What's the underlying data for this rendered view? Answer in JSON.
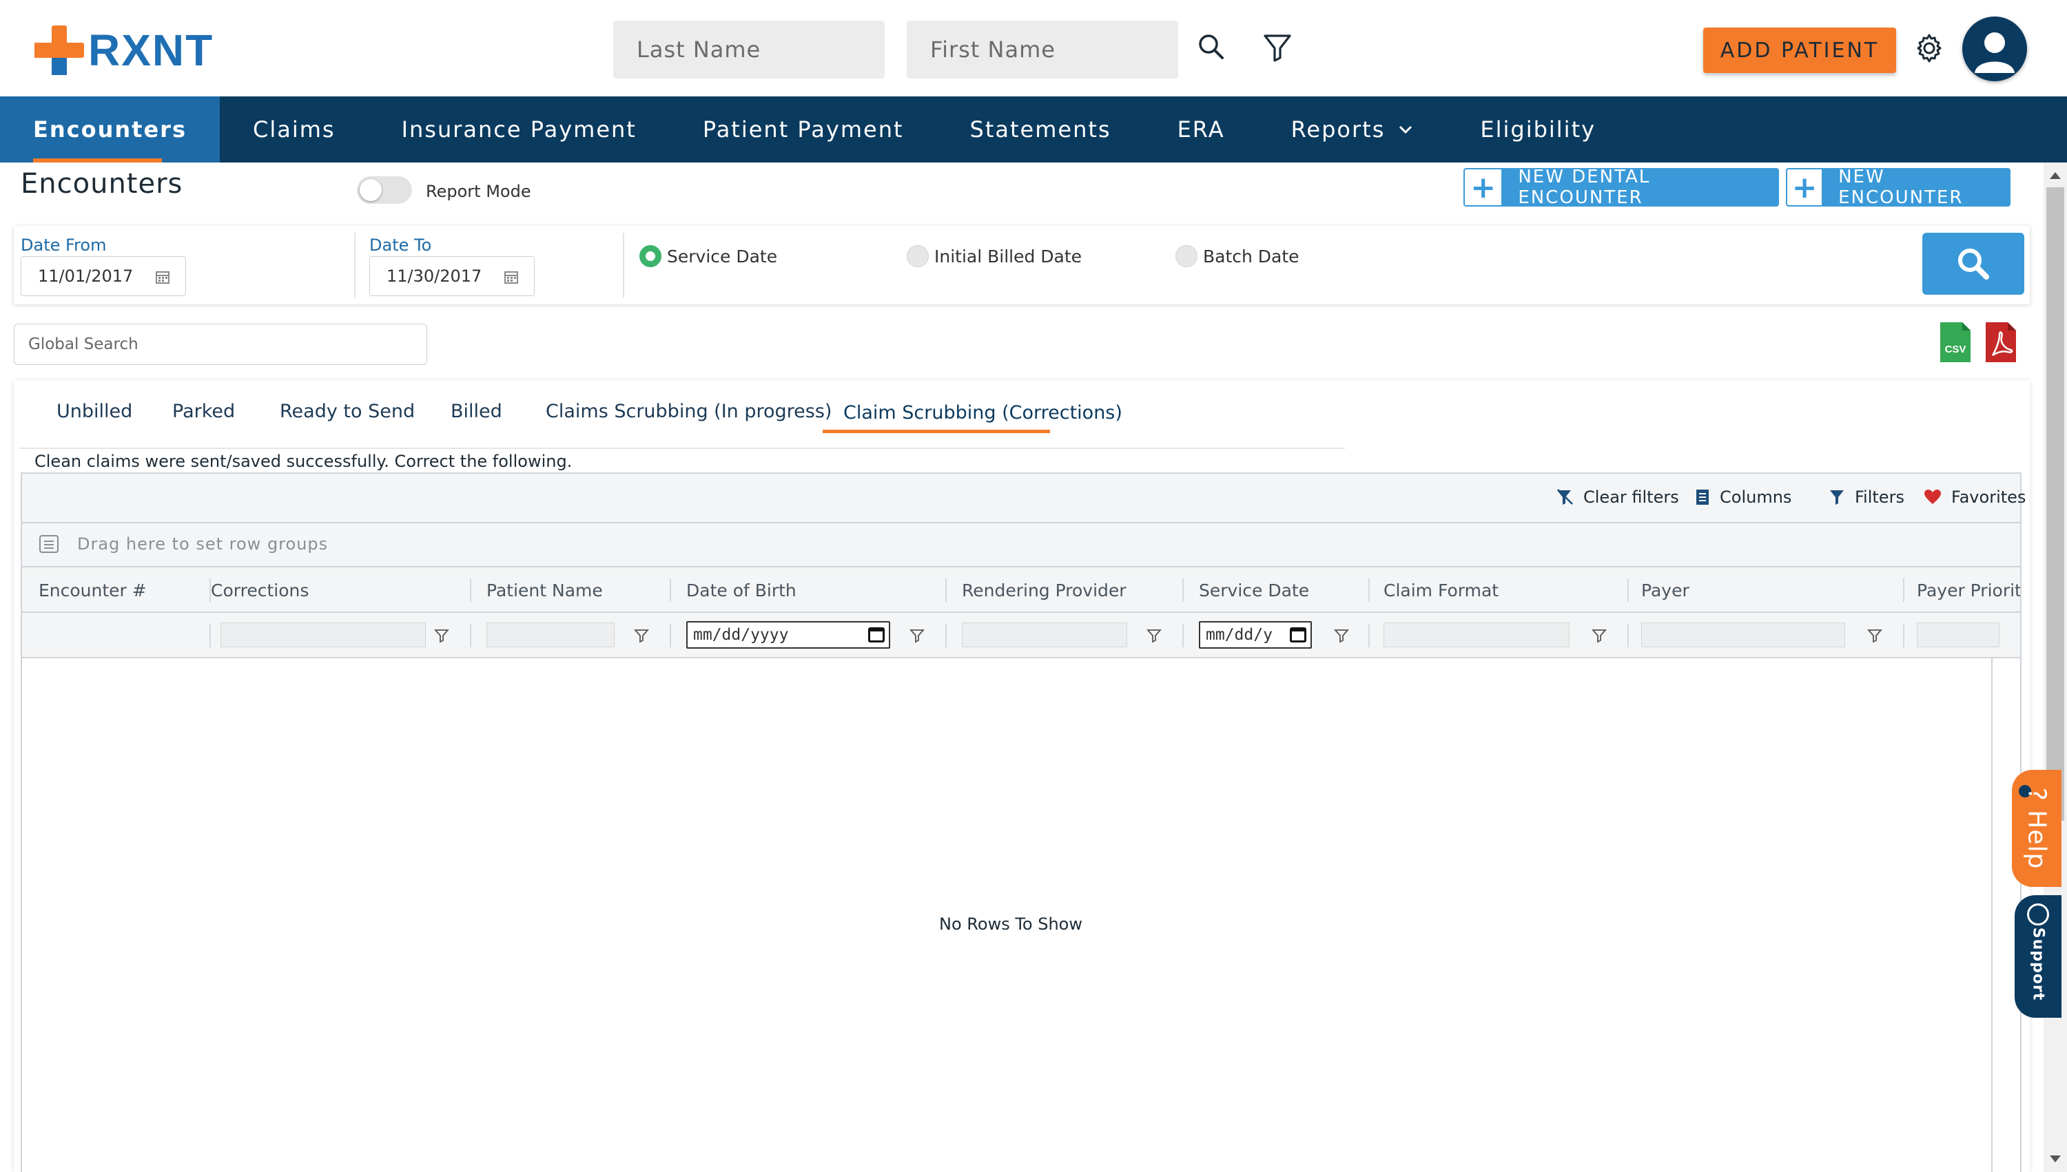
{
  "header": {
    "brand": "RXNT",
    "last_name_placeholder": "Last Name",
    "first_name_placeholder": "First Name",
    "add_patient_label": "ADD PATIENT"
  },
  "nav": {
    "items": [
      {
        "label": "Encounters",
        "active": true
      },
      {
        "label": "Claims"
      },
      {
        "label": "Insurance Payment"
      },
      {
        "label": "Patient Payment"
      },
      {
        "label": "Statements"
      },
      {
        "label": "ERA"
      },
      {
        "label": "Reports",
        "has_dropdown": true
      },
      {
        "label": "Eligibility"
      }
    ]
  },
  "page": {
    "title": "Encounters",
    "report_mode_label": "Report Mode",
    "report_mode_on": false,
    "new_dental_encounter_label": "NEW DENTAL ENCOUNTER",
    "new_encounter_label": "NEW ENCOUNTER"
  },
  "filters": {
    "date_from_label": "Date From",
    "date_from_value": "11/01/2017",
    "date_to_label": "Date To",
    "date_to_value": "11/30/2017",
    "radio_options": [
      "Service Date",
      "Initial Billed Date",
      "Batch Date"
    ],
    "radio_selected": "Service Date"
  },
  "global_search_placeholder": "Global Search",
  "export": {
    "csv_label": "CSV"
  },
  "tabs": [
    {
      "label": "Unbilled"
    },
    {
      "label": "Parked"
    },
    {
      "label": "Ready to Send"
    },
    {
      "label": "Billed"
    },
    {
      "label": "Claims Scrubbing (In progress)"
    },
    {
      "label": "Claim Scrubbing (Corrections)",
      "active": true
    }
  ],
  "info_text": "Clean claims were sent/saved successfully. Correct the following.",
  "grid": {
    "toolbar": {
      "clear_filters": "Clear filters",
      "columns": "Columns",
      "filters": "Filters",
      "favorites": "Favorites"
    },
    "row_groups_hint": "Drag here to set row groups",
    "columns": [
      "Encounter #",
      "Corrections",
      "Patient Name",
      "Date of Birth",
      "Rendering Provider",
      "Service Date",
      "Claim Format",
      "Payer",
      "Payer Priority"
    ],
    "date_placeholder": "mm/dd/yyyy",
    "date_placeholder_short": "mm/dd/y",
    "empty_message": "No Rows To Show"
  },
  "side_tabs": {
    "help": "Help",
    "support": "Support"
  },
  "colors": {
    "primary_navy": "#0b3a5f",
    "active_blue": "#1d6aa6",
    "accent_orange": "#f47b2a",
    "button_blue": "#3a9ad9",
    "radio_green": "#3bb36b"
  }
}
